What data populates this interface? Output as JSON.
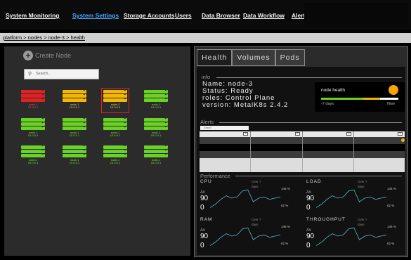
{
  "nav": {
    "items": [
      {
        "label": "System Monitoring",
        "active": false
      },
      {
        "label": "System Settings",
        "active": true
      },
      {
        "label": "Storage Accounts",
        "active": false
      },
      {
        "label": "Users",
        "active": false
      },
      {
        "label": "Data Browser",
        "active": false
      },
      {
        "label": "Data Workflow",
        "active": false
      },
      {
        "label": "Alerts",
        "active": false
      }
    ]
  },
  "breadcrumb": "platform > nodes > node-3 > health",
  "left": {
    "create_label": "Create Node",
    "search_placeholder": "Search...",
    "nodes": [
      {
        "name": "node-1",
        "ip": "10.0.0.1",
        "status": "red"
      },
      {
        "name": "node-1",
        "ip": "10.0.0.1",
        "status": "yellow"
      },
      {
        "name": "node-3",
        "ip": "10.0.0.3",
        "status": "yellow",
        "selected": true
      },
      {
        "name": "node-1",
        "ip": "10.0.0.1",
        "status": "green"
      },
      {
        "name": "node-1",
        "ip": "10.0.0.1",
        "status": "green"
      },
      {
        "name": "node-1",
        "ip": "10.0.0.1",
        "status": "green"
      },
      {
        "name": "node-1",
        "ip": "10.0.0.1",
        "status": "green"
      },
      {
        "name": "node-1",
        "ip": "10.0.0.1",
        "status": "green"
      },
      {
        "name": "node-1",
        "ip": "10.0.0.1",
        "status": "green"
      },
      {
        "name": "node-1",
        "ip": "10.0.0.1",
        "status": "green"
      },
      {
        "name": "node-1",
        "ip": "10.0.0.1",
        "status": "green"
      },
      {
        "name": "node-1",
        "ip": "10.0.0.1",
        "status": "green"
      }
    ]
  },
  "tabs": [
    {
      "label": "Health",
      "active": true
    },
    {
      "label": "Volumes",
      "active": false
    },
    {
      "label": "Pods",
      "active": false
    }
  ],
  "info": {
    "title": "info",
    "name": "Name: node-3",
    "status": "Status: Ready",
    "roles": "roles: Control Plane",
    "version": "version: MetalK8s 2.4.2"
  },
  "health_widget": {
    "title": "node health",
    "start_label": "-7 days",
    "end_label": "Now"
  },
  "alerts": {
    "title": "Alerts",
    "search_placeholder": "Search"
  },
  "performance": {
    "title": "Performance",
    "metrics": [
      {
        "name": "CPU",
        "over": "Over 7 days",
        "av_label": "Av",
        "value": "90",
        "zero": "0",
        "max": "146 %",
        "min": "62 %",
        "line": [
          0.1,
          0.25,
          0.45,
          0.6,
          0.5,
          0.55,
          0.8,
          0.85,
          0.35,
          0.5,
          0.55,
          0.45,
          0.5,
          0.55
        ]
      },
      {
        "name": "LOAD",
        "over": "Over 7 days",
        "av_label": "Av",
        "value": "90",
        "zero": "0",
        "max": "146 %",
        "min": "62 %",
        "line": [
          0.1,
          0.25,
          0.45,
          0.6,
          0.5,
          0.55,
          0.8,
          0.85,
          0.35,
          0.5,
          0.55,
          0.45,
          0.5,
          0.55
        ]
      },
      {
        "name": "RAM",
        "over": "Over 7 days",
        "av_label": "Av",
        "value": "90",
        "zero": "0",
        "max": "146 %",
        "min": "62 %",
        "line": [
          0.1,
          0.25,
          0.45,
          0.6,
          0.5,
          0.55,
          0.8,
          0.85,
          0.35,
          0.5,
          0.55,
          0.45,
          0.5,
          0.55
        ]
      },
      {
        "name": "THROUGHPUT",
        "over": "Over 7 days",
        "av_label": "Av",
        "value": "90",
        "zero": "0",
        "max": "146 %",
        "min": "62 %",
        "line": [
          0.1,
          0.25,
          0.45,
          0.6,
          0.5,
          0.55,
          0.8,
          0.85,
          0.35,
          0.5,
          0.55,
          0.45,
          0.5,
          0.55
        ]
      }
    ]
  }
}
